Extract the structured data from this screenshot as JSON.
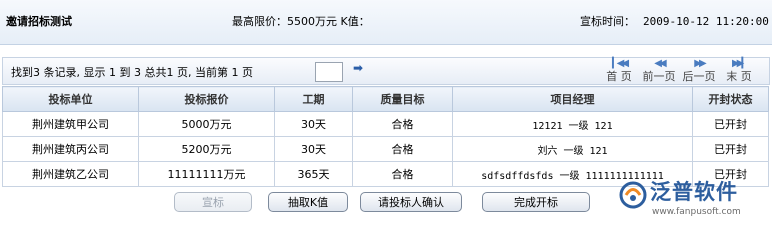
{
  "header": {
    "title": "邀请招标测试",
    "max_price": "最高限价：5500万元 K值：",
    "bid_time_label": "宣标时间：",
    "bid_time_value": "2009-10-12 11:20:00"
  },
  "pager": {
    "summary": "找到3 条记录, 显示 1 到 3 总共1 页, 当前第 1 页",
    "first": "首 页",
    "prev": "前一页",
    "next": "后一页",
    "last": "末 页"
  },
  "table": {
    "columns": [
      "投标单位",
      "投标报价",
      "工期",
      "质量目标",
      "项目经理",
      "开封状态"
    ],
    "rows": [
      [
        "荆州建筑甲公司",
        "5000万元",
        "30天",
        "合格",
        "12121 一级 121",
        "已开封"
      ],
      [
        "荆州建筑丙公司",
        "5200万元",
        "30天",
        "合格",
        "刘六 一级 121",
        "已开封"
      ],
      [
        "荆州建筑乙公司",
        "11111111万元",
        "365天",
        "合格",
        "sdfsdffdsfds 一级 1111111111111",
        "已开封"
      ]
    ]
  },
  "actions": {
    "announce": "宣标",
    "draw_k": "抽取K值",
    "confirm": "请投标人确认",
    "finish": "完成开标"
  },
  "brand": {
    "name": "泛普软件",
    "url": "www.fanpusoft.com",
    "color": "#2d5e9e"
  }
}
